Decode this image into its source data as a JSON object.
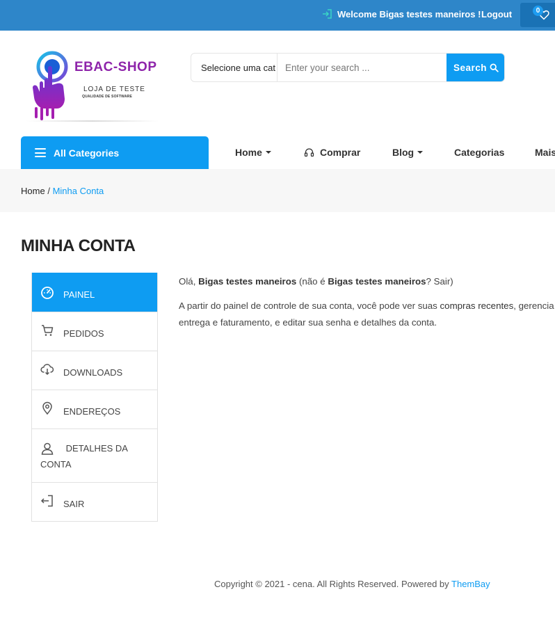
{
  "topbar": {
    "welcome": "Welcome Bigas testes maneiros !",
    "logout": "Logout",
    "wishlist_count": "0"
  },
  "logo": {
    "brand": "EBAC-SHOP",
    "subtitle": "LOJA DE TESTE",
    "tagline": "QUALIDADE DE SOFTWARE"
  },
  "search": {
    "category": "Selecione uma cat",
    "placeholder": "Enter your search ...",
    "button": "Search"
  },
  "nav": {
    "all_categories": "All Categories",
    "items": [
      "Home",
      "Comprar",
      "Blog",
      "Categorias",
      "Mais"
    ]
  },
  "breadcrumb": {
    "home": "Home",
    "separator": "/",
    "current": "Minha Conta"
  },
  "page": {
    "title": "MINHA CONTA"
  },
  "account_nav": [
    {
      "label": "Painel",
      "icon": "dashboard-icon",
      "active": true
    },
    {
      "label": "Pedidos",
      "icon": "cart-icon",
      "active": false
    },
    {
      "label": "Downloads",
      "icon": "cloud-download-icon",
      "active": false
    },
    {
      "label": "Endereços",
      "icon": "location-pin-icon",
      "active": false
    },
    {
      "label": "Detalhes da conta",
      "icon": "user-icon",
      "active": false
    },
    {
      "label": "Sair",
      "icon": "logout-icon",
      "active": false
    }
  ],
  "content": {
    "greeting_prefix": "Olá,",
    "user_name": "Bigas testes maneiros",
    "not_you_prefix": "(não é",
    "not_you_name": "Bigas testes maneiros",
    "logout_link": "? Sair)",
    "intro": "A partir do painel de controle de sua conta, você pode ver suas",
    "recent_orders": "compras recentes",
    "manage": ", gerencia",
    "intro_line2": "entrega e faturamento, e editar sua senha e detalhes da conta."
  },
  "footer": {
    "copyright": "Copyright © 2021 - cena. All Rights Reserved. Powered by",
    "powered_by": "ThemBay"
  },
  "colors": {
    "topbar": "#2e86c9",
    "accent": "#0e9cf2",
    "brand_purple": "#8e24aa"
  }
}
